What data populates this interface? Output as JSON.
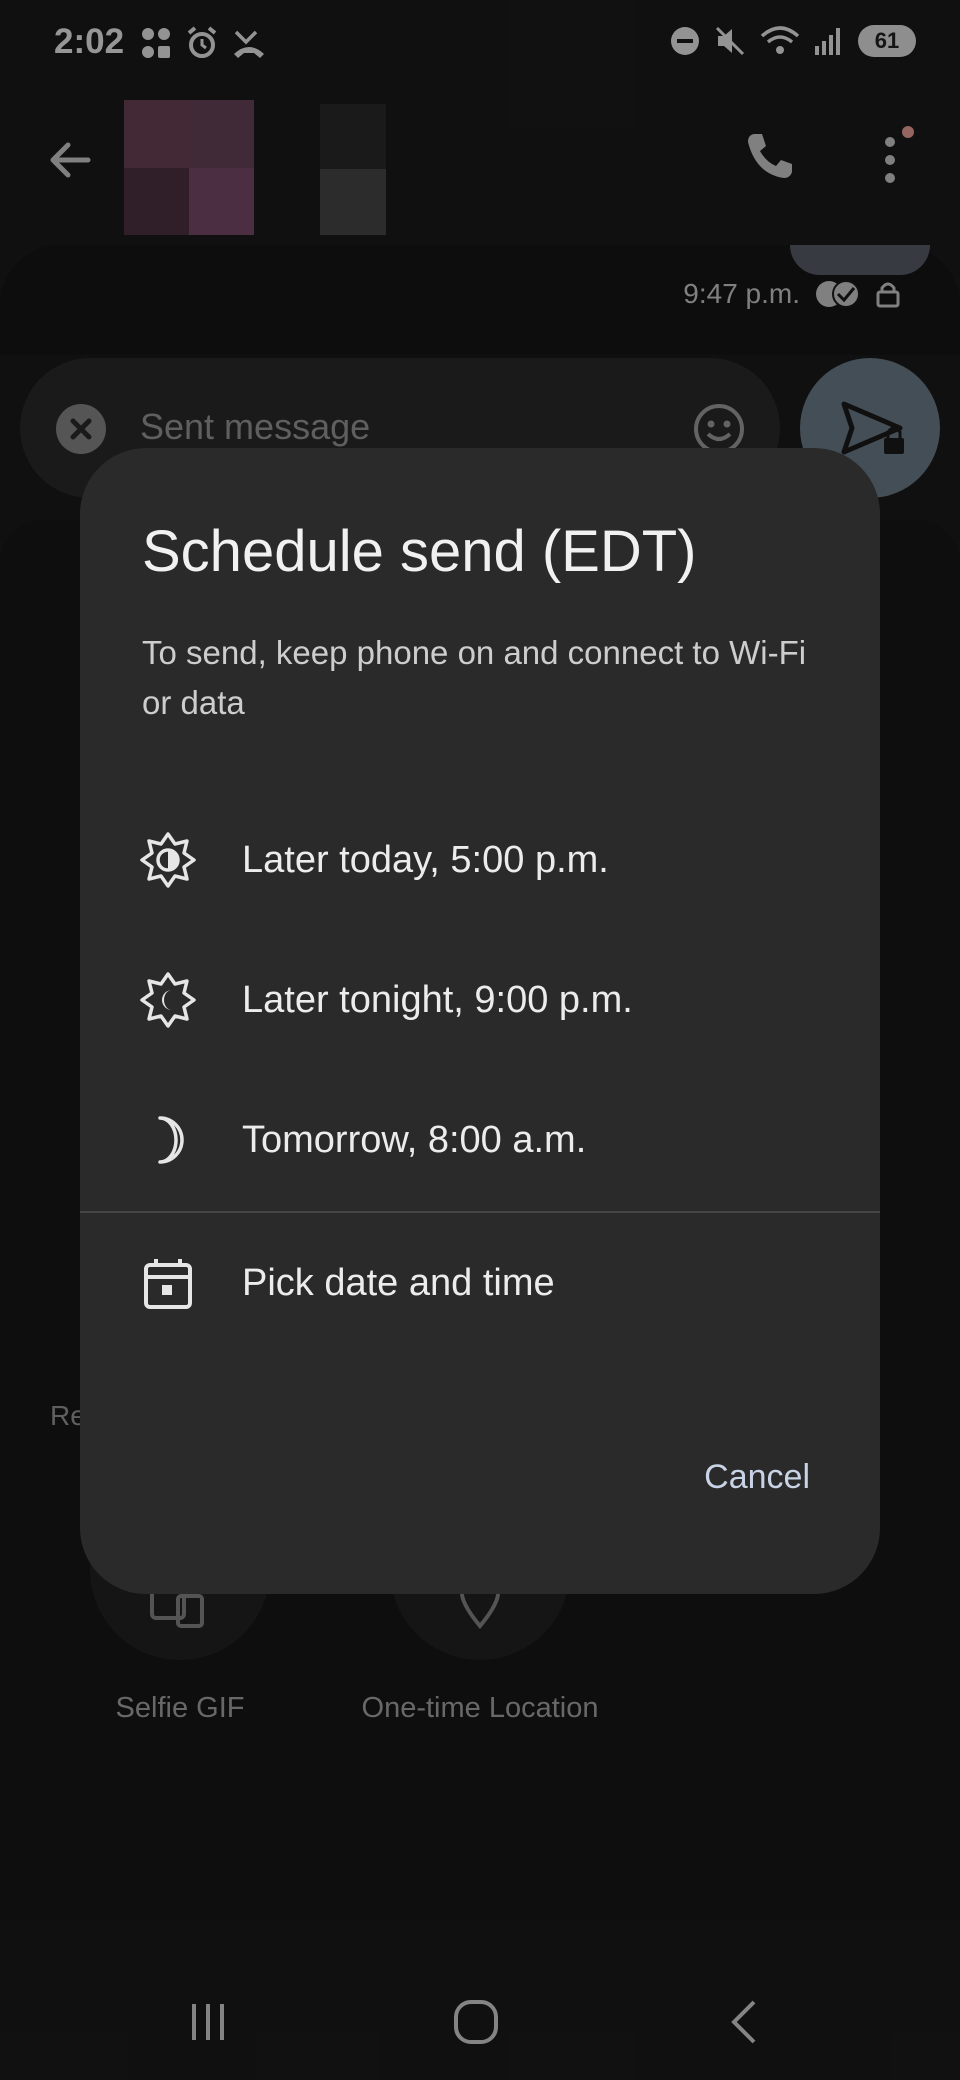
{
  "status_bar": {
    "time": "2:02",
    "battery": "61",
    "signal_indicator": "5"
  },
  "conversation": {
    "last_message_time": "9:47 p.m."
  },
  "compose": {
    "text": "Sent message"
  },
  "background": {
    "partial_label_left": "Re",
    "attachments": [
      {
        "label": "Selfie GIF",
        "icon": "selfie-gif-icon"
      },
      {
        "label": "One-time Location",
        "icon": "location-icon"
      }
    ]
  },
  "dialog": {
    "title": "Schedule send (EDT)",
    "subtitle": "To send, keep phone on and connect to Wi-Fi or data",
    "options": [
      {
        "label": "Later today, 5:00 p.m.",
        "icon": "sun-half-icon"
      },
      {
        "label": "Later tonight, 9:00 p.m.",
        "icon": "sun-dim-icon"
      },
      {
        "label": "Tomorrow, 8:00 a.m.",
        "icon": "moon-icon"
      },
      {
        "label": "Pick date and time",
        "icon": "calendar-icon"
      }
    ],
    "cancel_label": "Cancel"
  },
  "colors": {
    "dialog_bg": "#2a2a2a",
    "accent": "#c8d3e6",
    "send_button": "#6e7f8c"
  }
}
